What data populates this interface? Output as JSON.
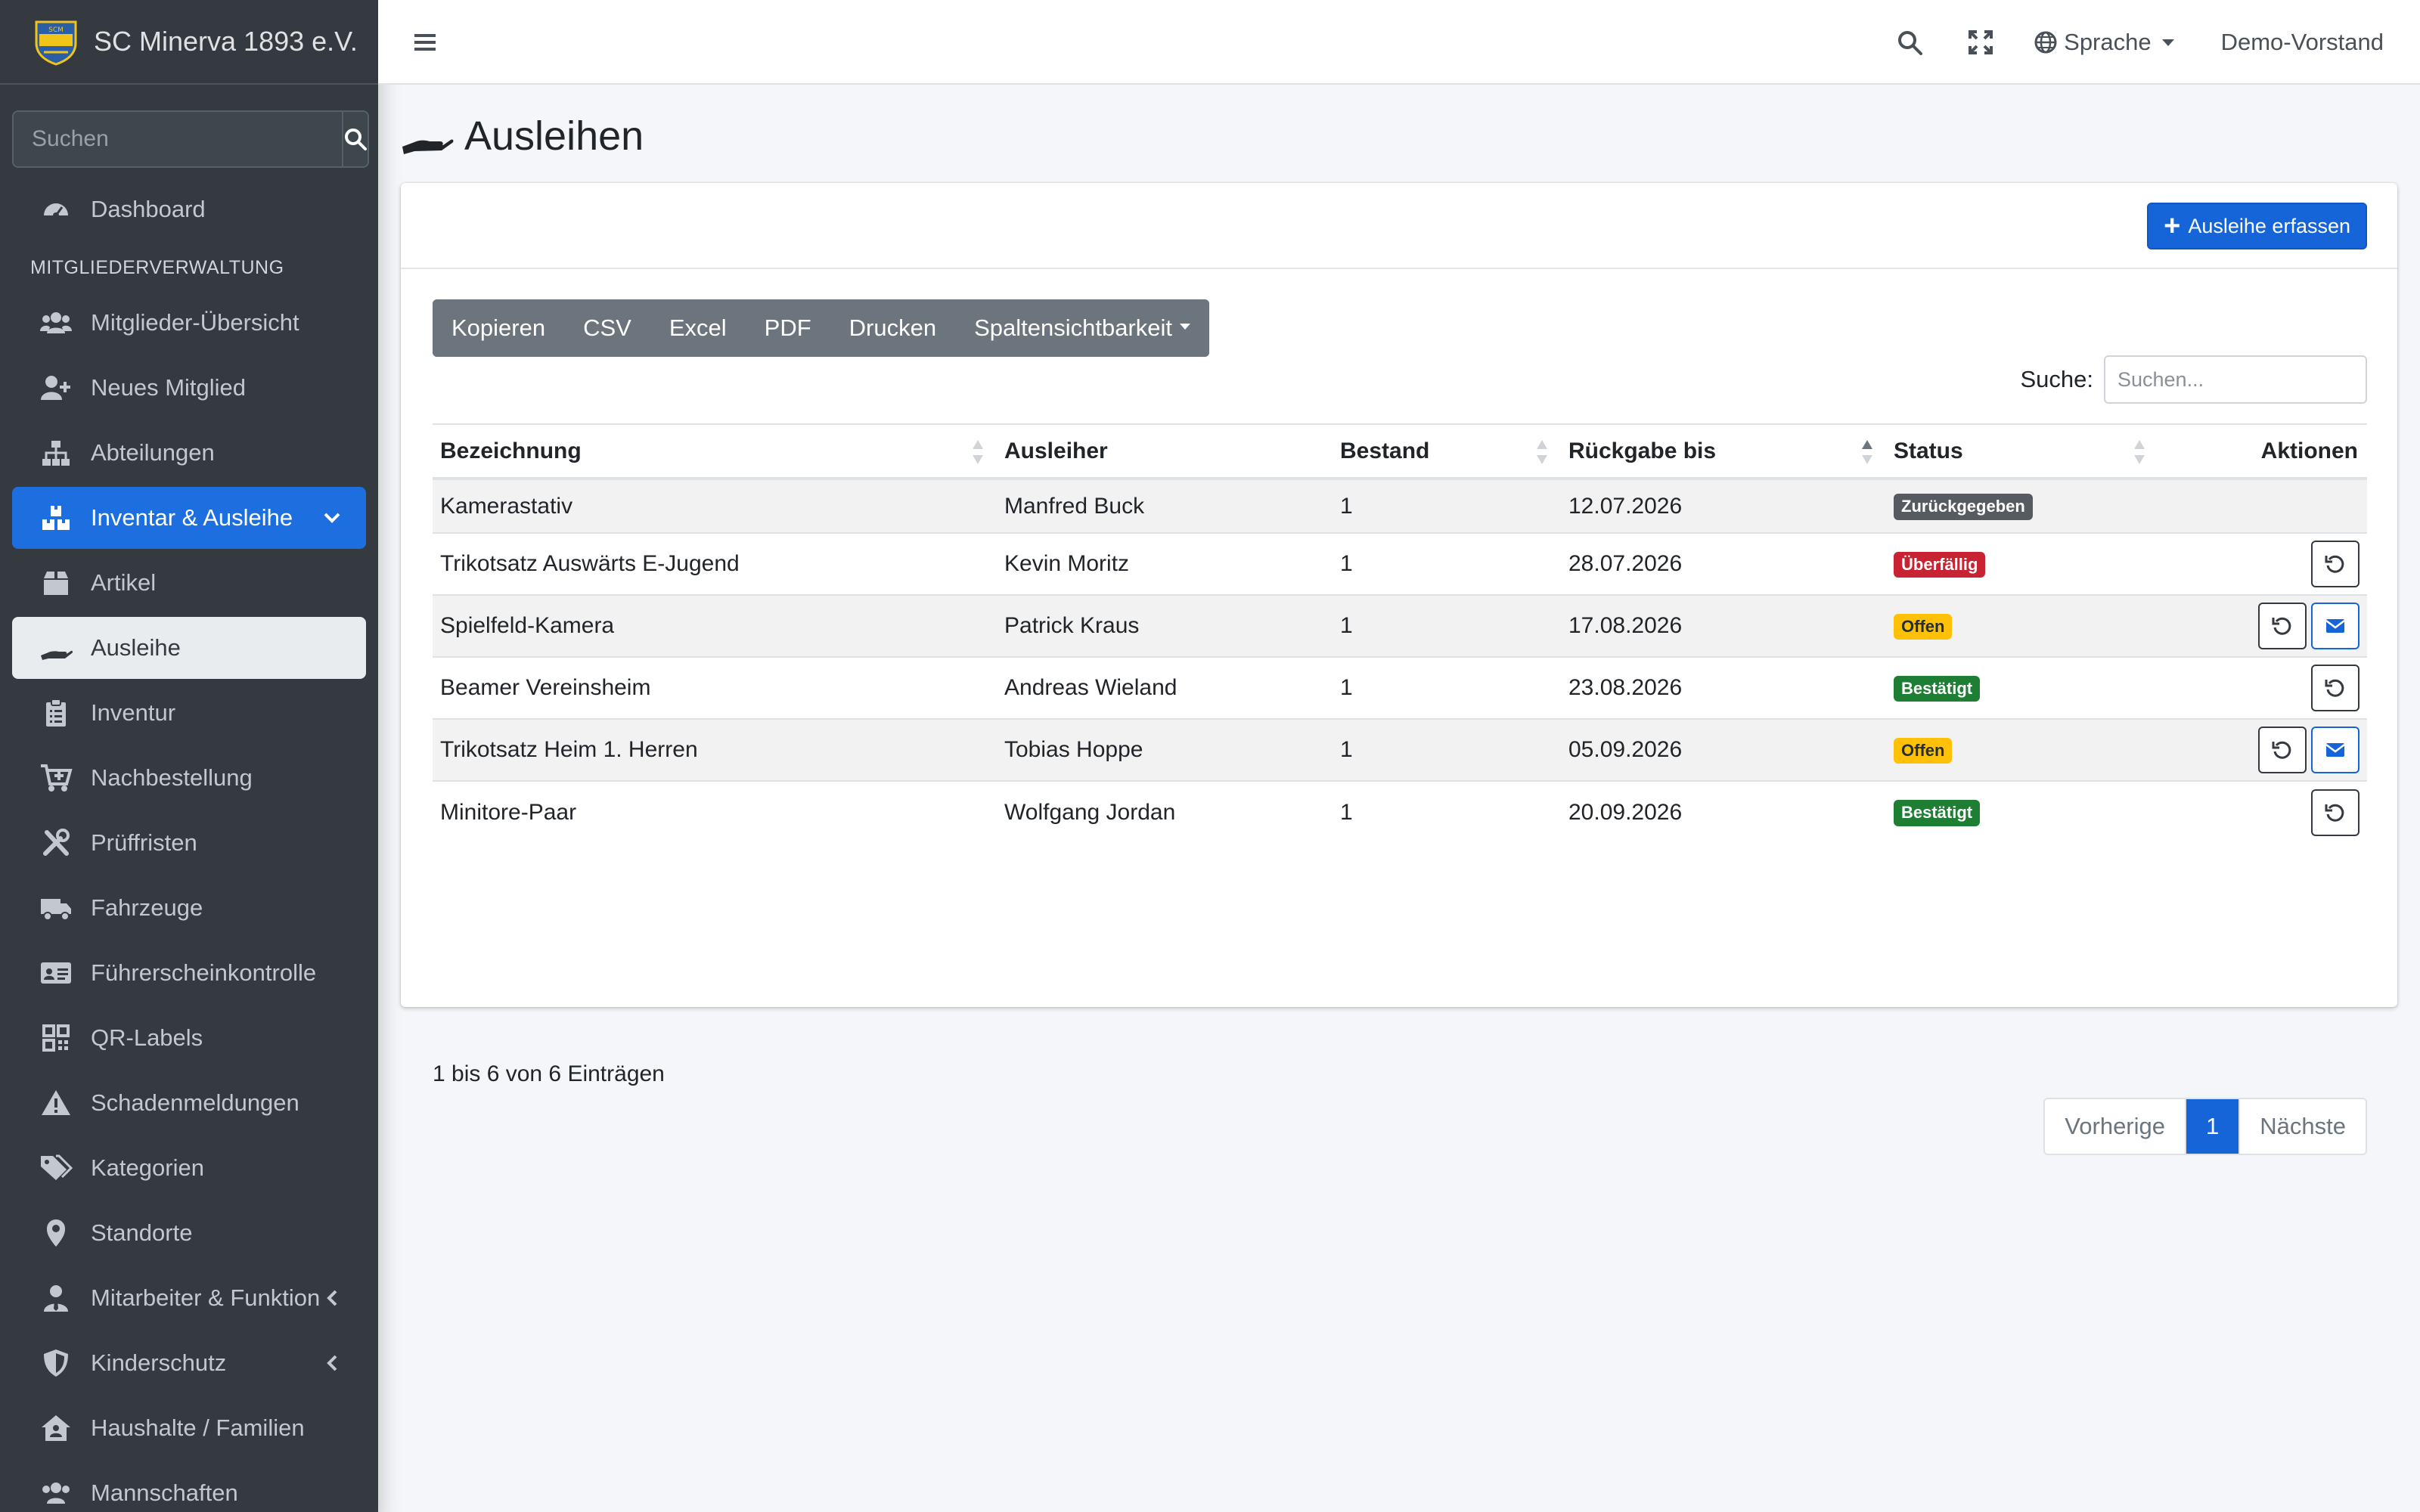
{
  "brand": {
    "name": "SC Minerva 1893 e.V.",
    "logo_text": "SCM"
  },
  "sidebar": {
    "search_placeholder": "Suchen",
    "items": [
      {
        "label": "Dashboard",
        "icon": "dashboard-icon"
      },
      {
        "header": "MITGLIEDERVERWALTUNG"
      },
      {
        "label": "Mitglieder-Übersicht",
        "icon": "users-icon"
      },
      {
        "label": "Neues Mitglied",
        "icon": "user-plus-icon"
      },
      {
        "label": "Abteilungen",
        "icon": "sitemap-icon"
      },
      {
        "label": "Inventar & Ausleihe",
        "icon": "boxes-icon",
        "state": "expanded"
      },
      {
        "label": "Artikel",
        "icon": "box-icon"
      },
      {
        "label": "Ausleihe",
        "icon": "hand-holding-icon",
        "state": "active"
      },
      {
        "label": "Inventur",
        "icon": "clipboard-list-icon"
      },
      {
        "label": "Nachbestellung",
        "icon": "cart-plus-icon"
      },
      {
        "label": "Prüffristen",
        "icon": "tools-icon"
      },
      {
        "label": "Fahrzeuge",
        "icon": "truck-icon"
      },
      {
        "label": "Führerscheinkontrolle",
        "icon": "id-card-icon"
      },
      {
        "label": "QR-Labels",
        "icon": "qrcode-icon"
      },
      {
        "label": "Schadenmeldungen",
        "icon": "warning-icon"
      },
      {
        "label": "Kategorien",
        "icon": "tags-icon"
      },
      {
        "label": "Standorte",
        "icon": "map-marker-icon"
      },
      {
        "label": "Mitarbeiter & Funktion",
        "icon": "user-tie-icon"
      },
      {
        "label": "Kinderschutz",
        "icon": "shield-icon"
      },
      {
        "label": "Haushalte / Familien",
        "icon": "house-user-icon"
      },
      {
        "label": "Mannschaften",
        "icon": "team-icon"
      }
    ]
  },
  "topbar": {
    "language_label": "Sprache",
    "user_label": "Demo-Vorstand"
  },
  "page": {
    "title": "Ausleihen",
    "add_button": "Ausleihe erfassen"
  },
  "datatable": {
    "buttons": [
      "Kopieren",
      "CSV",
      "Excel",
      "PDF",
      "Drucken",
      "Spaltensichtbarkeit"
    ],
    "search_label": "Suche:",
    "search_placeholder": "Suchen...",
    "columns": [
      "Bezeichnung",
      "Ausleiher",
      "Bestand",
      "Rückgabe bis",
      "Status",
      "Aktionen"
    ],
    "rows": [
      {
        "bezeichnung": "Kamerastativ",
        "ausleiher": "Manfred Buck",
        "bestand": "1",
        "rueckgabe": "12.07.2026",
        "status": "Zurückgegeben",
        "status_color": "#555b61",
        "status_text_color": "#ffffff",
        "actions": []
      },
      {
        "bezeichnung": "Trikotsatz Auswärts E-Jugend",
        "ausleiher": "Kevin Moritz",
        "bestand": "1",
        "rueckgabe": "28.07.2026",
        "status": "Überfällig",
        "status_color": "#c82333",
        "status_text_color": "#ffffff",
        "actions": [
          "undo-icon"
        ]
      },
      {
        "bezeichnung": "Spielfeld-Kamera",
        "ausleiher": "Patrick Kraus",
        "bestand": "1",
        "rueckgabe": "17.08.2026",
        "status": "Offen",
        "status_color": "#ffc107",
        "status_text_color": "#1f2d3d",
        "actions": [
          "undo-icon",
          "envelope-icon"
        ]
      },
      {
        "bezeichnung": "Beamer Vereinsheim",
        "ausleiher": "Andreas Wieland",
        "bestand": "1",
        "rueckgabe": "23.08.2026",
        "status": "Bestätigt",
        "status_color": "#1e7e34",
        "status_text_color": "#ffffff",
        "actions": [
          "undo-icon"
        ]
      },
      {
        "bezeichnung": "Trikotsatz Heim 1. Herren",
        "ausleiher": "Tobias Hoppe",
        "bestand": "1",
        "rueckgabe": "05.09.2026",
        "status": "Offen",
        "status_color": "#ffc107",
        "status_text_color": "#1f2d3d",
        "actions": [
          "undo-icon",
          "envelope-icon"
        ]
      },
      {
        "bezeichnung": "Minitore-Paar",
        "ausleiher": "Wolfgang Jordan",
        "bestand": "1",
        "rueckgabe": "20.09.2026",
        "status": "Bestätigt",
        "status_color": "#1e7e34",
        "status_text_color": "#ffffff",
        "actions": [
          "undo-icon"
        ]
      }
    ],
    "info": "1 bis 6 von 6 Einträgen",
    "pagination": {
      "prev": "Vorherige",
      "current": "1",
      "next": "Nächste"
    }
  },
  "colors": {
    "sidebar_bg": "#343a40",
    "primary": "#1565d8",
    "content_bg": "#f4f6f9"
  }
}
